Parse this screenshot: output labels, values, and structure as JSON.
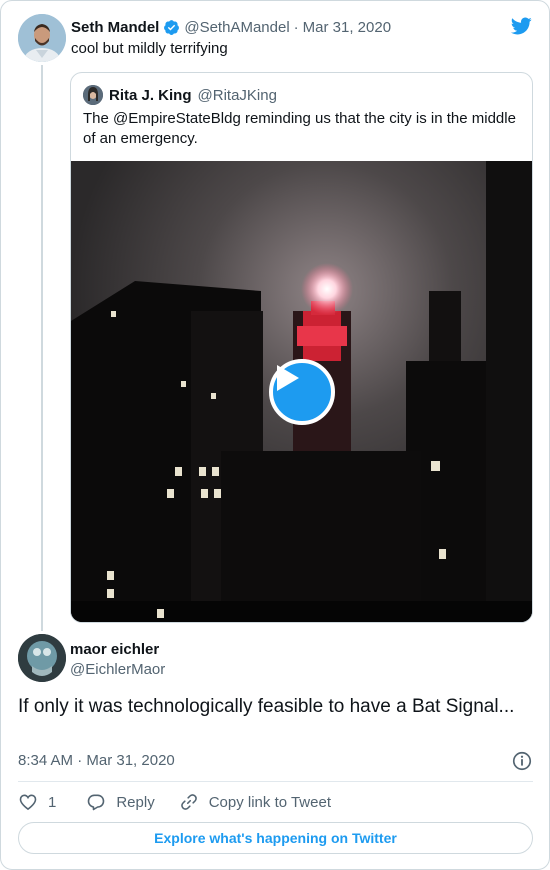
{
  "tweet": {
    "author_name": "Seth Mandel",
    "author_handle": "@SethAMandel",
    "separator": "·",
    "date": "Mar 31, 2020",
    "text": "cool but mildly terrifying"
  },
  "quoted": {
    "author_name": "Rita J. King",
    "author_handle": "@RitaJKing",
    "text": "The @EmpireStateBldg reminding us that the city is in the middle of an emergency."
  },
  "reply": {
    "author_name": "maor eichler",
    "author_handle": "@EichlerMaor",
    "text": "If only it was technologically feasible to have a Bat Signal...",
    "timestamp": "8:34 AM · Mar 31, 2020"
  },
  "actions": {
    "like_count": "1",
    "reply_label": "Reply",
    "copy_link_label": "Copy link to Tweet"
  },
  "footer": {
    "explore_label": "Explore what's happening on Twitter"
  },
  "colors": {
    "accent": "#1d9bf0",
    "border": "#cfd9de",
    "secondary_text": "#536471"
  },
  "icons": [
    "verified-badge-icon",
    "twitter-bird-icon",
    "play-icon",
    "info-icon",
    "heart-icon",
    "reply-bubble-icon",
    "link-icon"
  ]
}
